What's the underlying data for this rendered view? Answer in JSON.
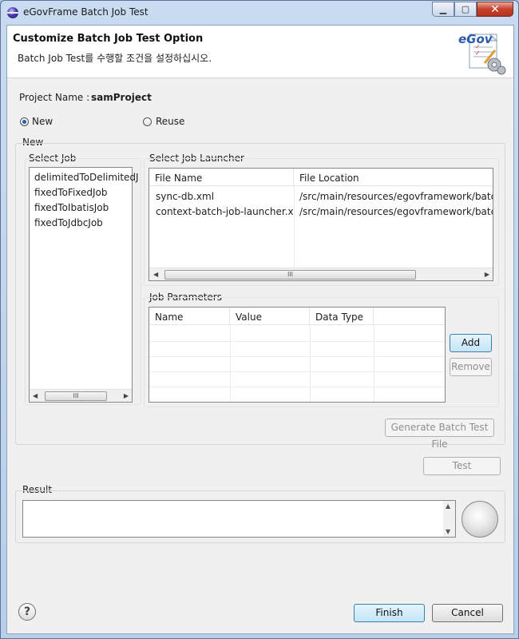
{
  "window": {
    "title": "eGovFrame Batch Job Test",
    "controls": {
      "minimize": "▁",
      "maximize": "▢",
      "close": "✕"
    }
  },
  "header": {
    "title": "Customize Batch Job Test Option",
    "description": "Batch Job Test를 수행할 조건을 설정하십시오.",
    "logo_text": "eGov"
  },
  "project": {
    "label": "Project Name :",
    "value": "samProject"
  },
  "mode": {
    "options": [
      {
        "label": "New",
        "selected": true
      },
      {
        "label": "Reuse",
        "selected": false
      }
    ]
  },
  "new_group": {
    "label": "New",
    "select_job": {
      "label": "Select Job",
      "items": [
        "delimitedToDelimitedJ",
        "fixedToFixedJob",
        "fixedToIbatisJob",
        "fixedToJdbcJob"
      ],
      "scroll_thumb": "III"
    },
    "launcher": {
      "label": "Select Job Launcher",
      "columns": [
        "File Name",
        "File Location"
      ],
      "rows": [
        [
          "sync-db.xml",
          "/src/main/resources/egovframework/batch/s"
        ],
        [
          "context-batch-job-launcher.x...",
          "/src/main/resources/egovframework/batch/c"
        ]
      ],
      "scroll_thumb": "III"
    },
    "parameters": {
      "label": "Job Parameters",
      "columns": [
        "Name",
        "Value",
        "Data Type"
      ],
      "add_label": "Add",
      "remove_label": "Remove"
    },
    "generate_label": "Generate Batch Test File"
  },
  "test_label": "Test",
  "result": {
    "label": "Result",
    "value": ""
  },
  "footer": {
    "help_symbol": "?",
    "finish_label": "Finish",
    "cancel_label": "Cancel"
  }
}
